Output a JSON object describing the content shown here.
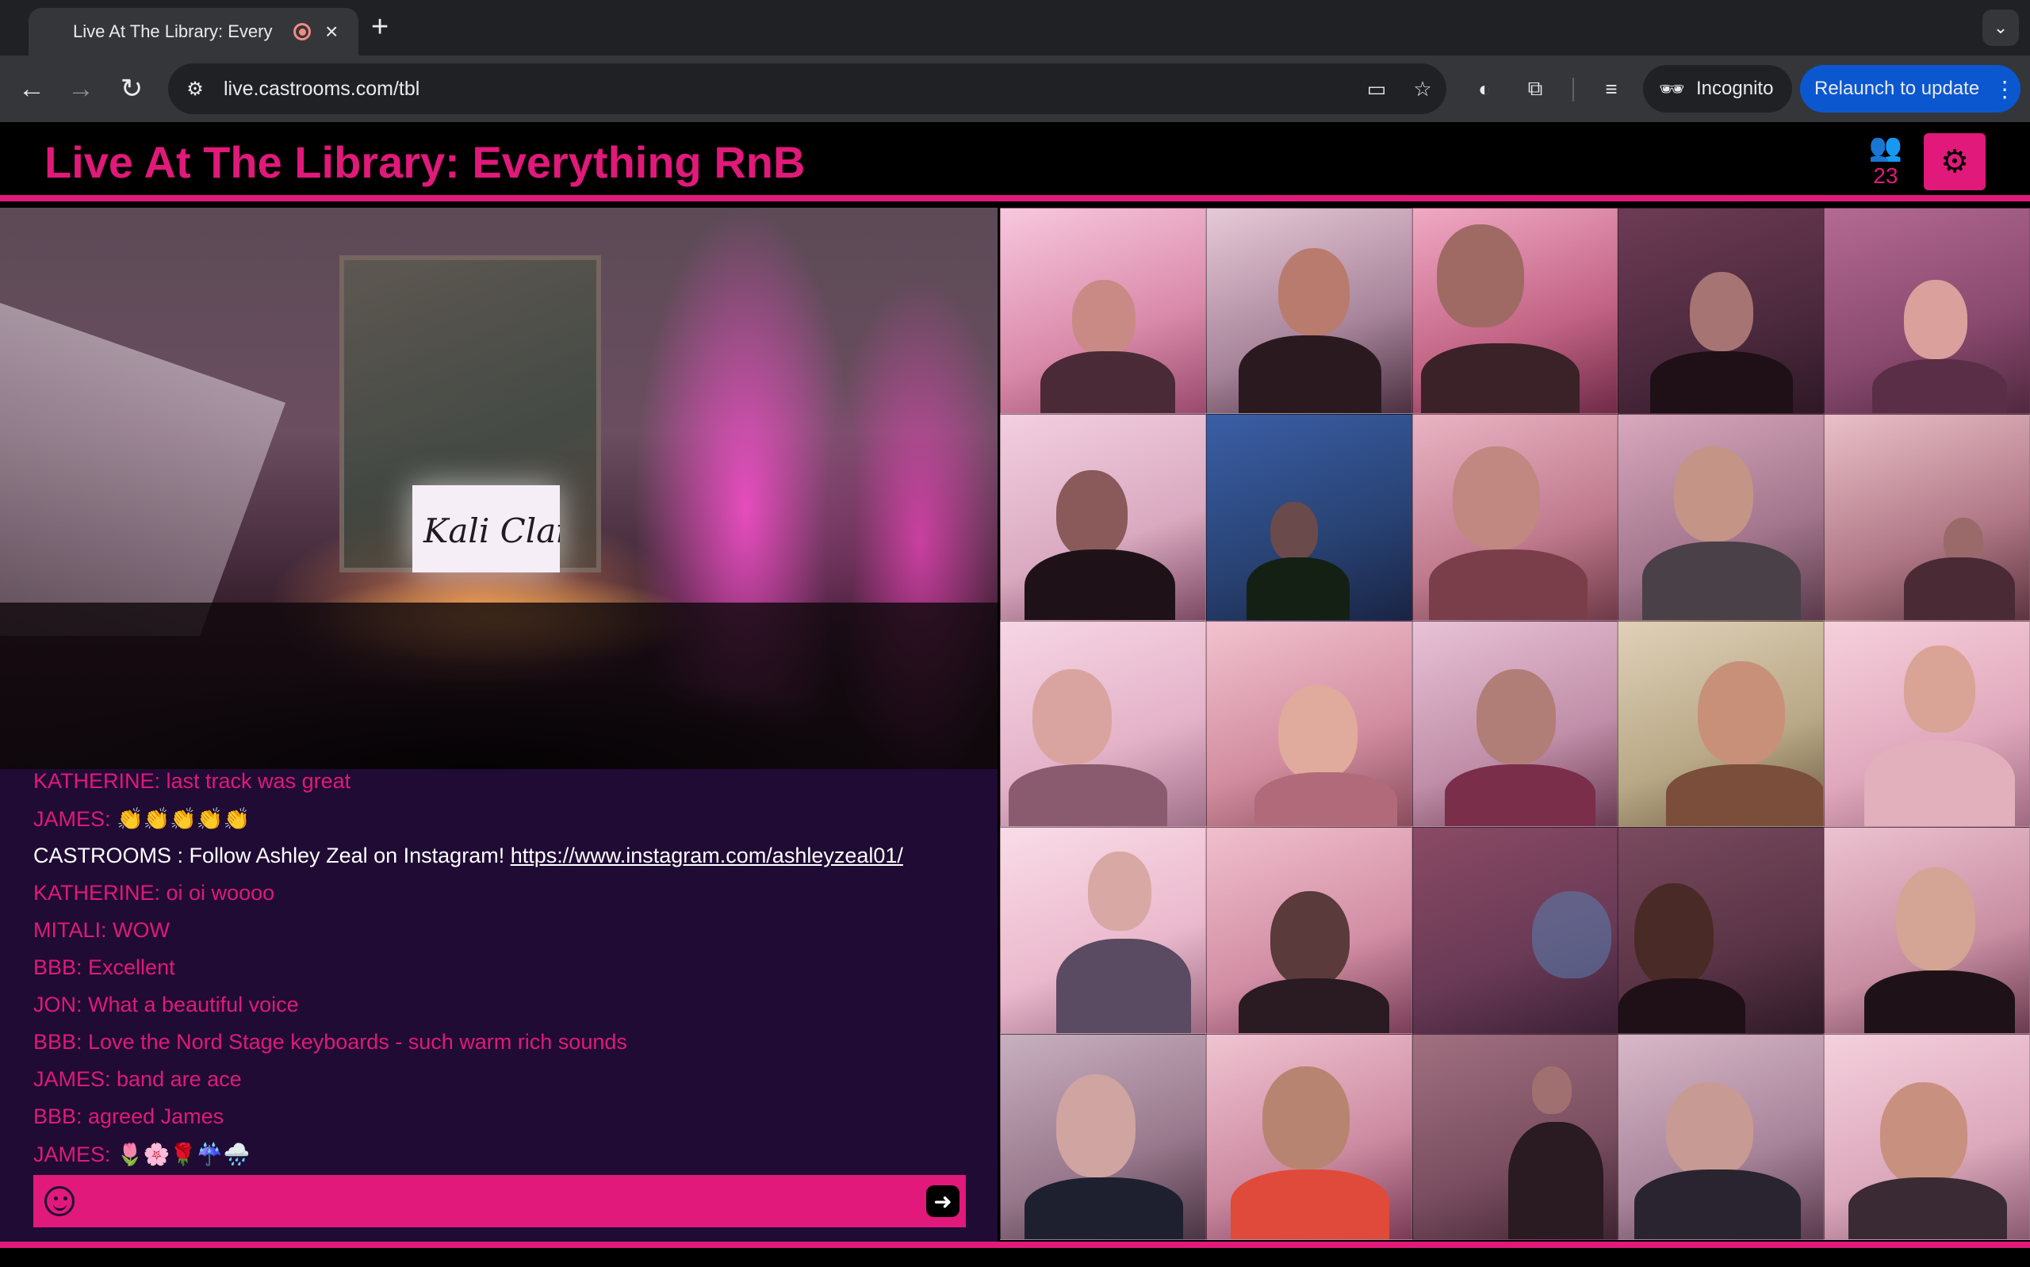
{
  "browser": {
    "tab_title": "Live At The Library: Every",
    "url": "live.castrooms.com/tbl",
    "incognito_label": "Incognito",
    "relaunch_label": "Relaunch to update"
  },
  "app": {
    "title": "Live At The Library: Everything RnB",
    "viewer_count": "23",
    "accent_color": "#e0197a",
    "chat_bg_color": "#1f0b34"
  },
  "stage": {
    "sign_text": "Kali Claire"
  },
  "chat": {
    "messages": [
      {
        "text": "KATHERINE: last track was great"
      },
      {
        "text": "JAMES: 👏👏👏👏👏"
      },
      {
        "text": "CASTROOMS : Follow Ashley Zeal on Instagram! ",
        "link": "https://www.instagram.com/ashleyzeal01/"
      },
      {
        "text": "KATHERINE: oi oi woooo"
      },
      {
        "text": "MITALI: WOW"
      },
      {
        "text": "BBB: Excellent"
      },
      {
        "text": "JON: What a beautiful voice"
      },
      {
        "text": "BBB: Love the Nord Stage keyboards - such warm rich sounds"
      },
      {
        "text": "JAMES: band are ace"
      },
      {
        "text": "BBB: agreed James"
      },
      {
        "text": "JAMES: 🌷🌸🌹☔🌧️"
      }
    ],
    "input_placeholder": ""
  },
  "icons": {
    "back": "arrow-left-icon",
    "forward": "arrow-right-icon",
    "reload": "reload-icon",
    "site_info": "tune-icon",
    "camera": "video-camera-icon",
    "bookmark": "star-icon",
    "extensions": "puzzle-icon",
    "media": "media-control-icon",
    "viewers": "people-icon",
    "settings": "gear-icon",
    "emoji": "smiley-icon",
    "send": "arrow-right-icon"
  }
}
